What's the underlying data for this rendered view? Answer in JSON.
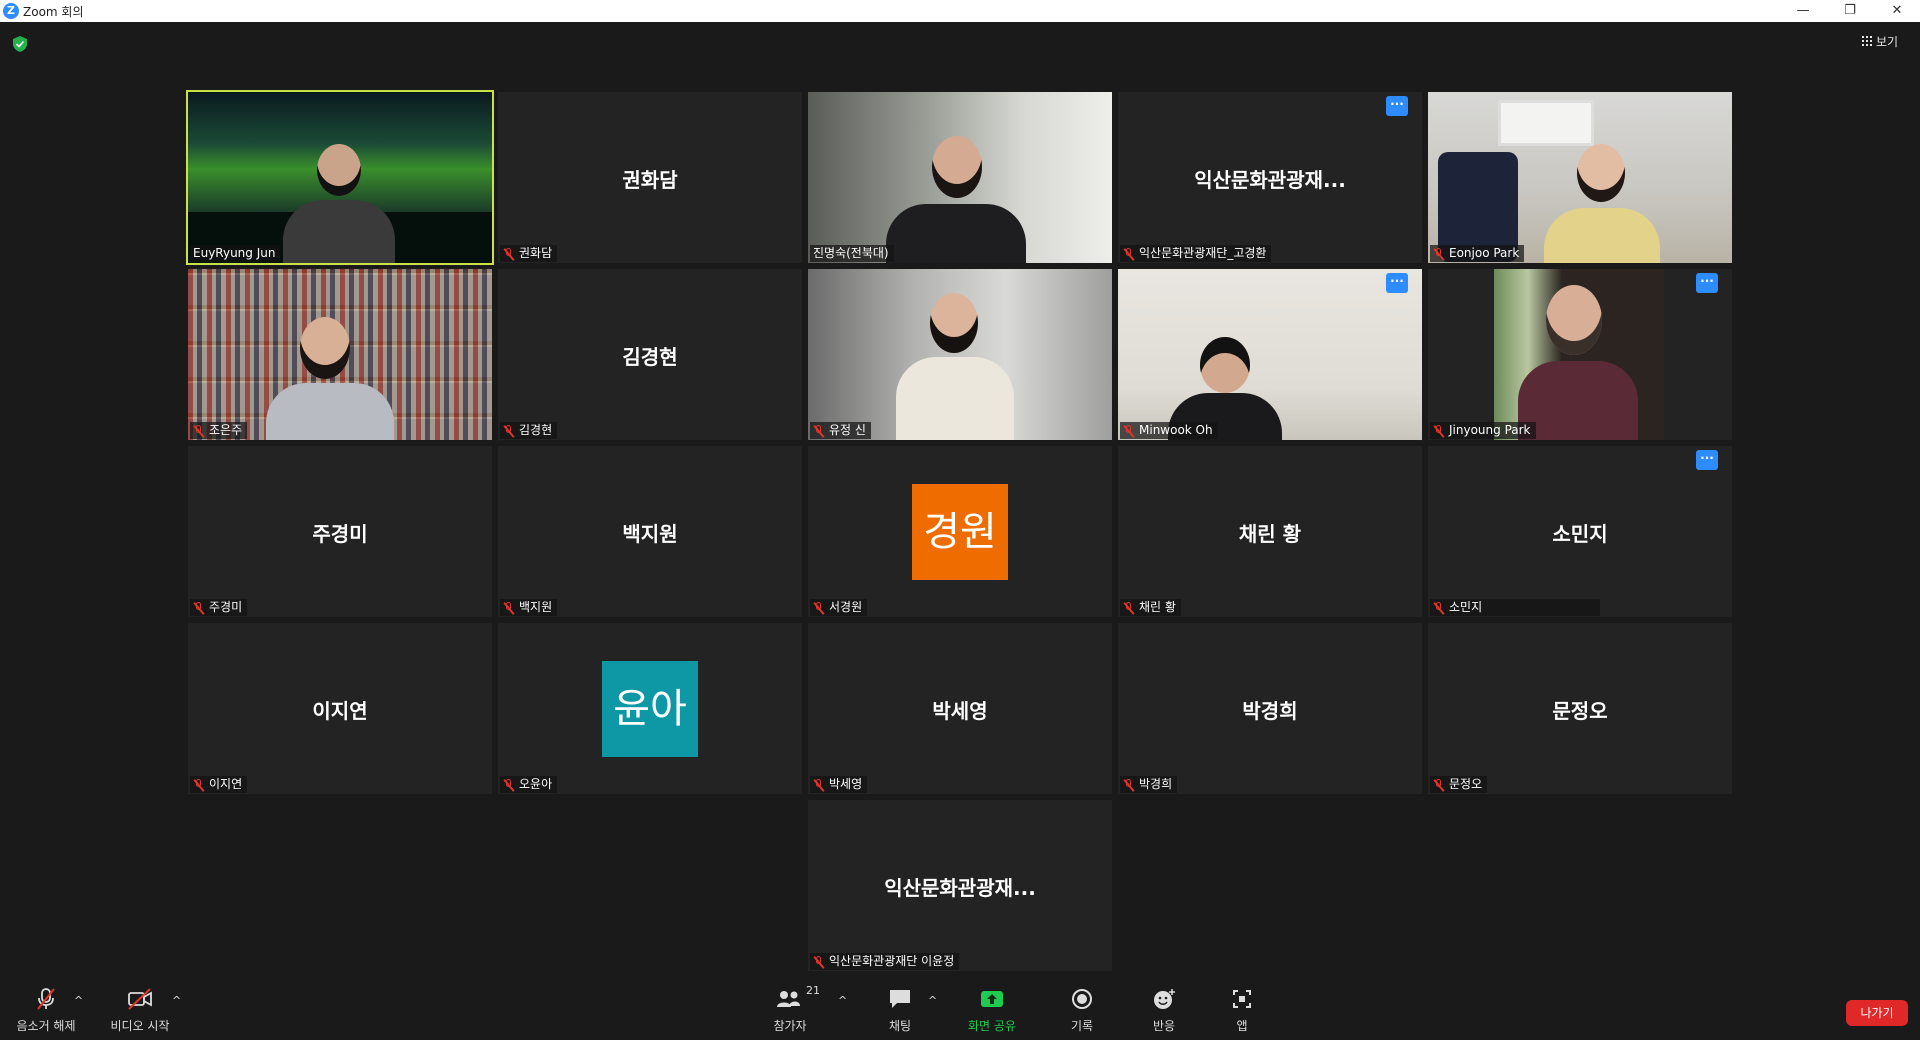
{
  "window": {
    "title": "Zoom 회의",
    "controls": [
      "—",
      "❐",
      "✕"
    ]
  },
  "view_label": "보기",
  "tiles": [
    {
      "name": "EuyRyung Jun",
      "center": "",
      "muted": false
    },
    {
      "name": "권화담",
      "center": "권화담",
      "muted": true
    },
    {
      "name": "진명숙(전북대)",
      "center": "",
      "muted": false
    },
    {
      "name": "익산문화관광재단_고경환",
      "center": "익산문화관광재...",
      "muted": true,
      "more": "···"
    },
    {
      "name": "Eonjoo Park",
      "center": "",
      "muted": true
    },
    {
      "name": "조은주",
      "center": "",
      "muted": true
    },
    {
      "name": "김경현",
      "center": "김경현",
      "muted": true
    },
    {
      "name": "유정 신",
      "center": "",
      "muted": true
    },
    {
      "name": "Minwook Oh",
      "center": "",
      "muted": true,
      "more": "···"
    },
    {
      "name": "Jinyoung Park",
      "center": "",
      "muted": true,
      "more": "···"
    },
    {
      "name": "주경미",
      "center": "주경미",
      "muted": true
    },
    {
      "name": "백지원",
      "center": "백지원",
      "muted": true
    },
    {
      "name": "서경원",
      "center": "",
      "muted": true,
      "avatar": "경원",
      "avatar_color": "#ef6c00"
    },
    {
      "name": "채린 황",
      "center": "채린 황",
      "muted": true
    },
    {
      "name": "소민지",
      "center": "소민지",
      "muted": true,
      "more": "···"
    },
    {
      "name": "이지연",
      "center": "이지연",
      "muted": true
    },
    {
      "name": "오윤아",
      "center": "",
      "muted": true,
      "avatar": "윤아",
      "avatar_color": "#0e98a5"
    },
    {
      "name": "박세영",
      "center": "박세영",
      "muted": true
    },
    {
      "name": "박경희",
      "center": "박경희",
      "muted": true
    },
    {
      "name": "문정오",
      "center": "문정오",
      "muted": true
    },
    {
      "name": "익산문화관광재단 이윤정",
      "center": "익산문화관광재...",
      "muted": true
    }
  ],
  "toolbar": {
    "unmute": "음소거 해제",
    "start_video": "비디오 시작",
    "participants": "참가자",
    "participants_count": "21",
    "chat": "채팅",
    "share_screen": "화면 공유",
    "record": "기록",
    "reactions": "반응",
    "apps": "앱",
    "leave": "나가기",
    "caret": "^"
  },
  "colors": {
    "active_speaker": "#c9e24a",
    "accent_blue": "#2d8cff",
    "share_green": "#1fcc4f",
    "leave_red": "#e02828"
  }
}
